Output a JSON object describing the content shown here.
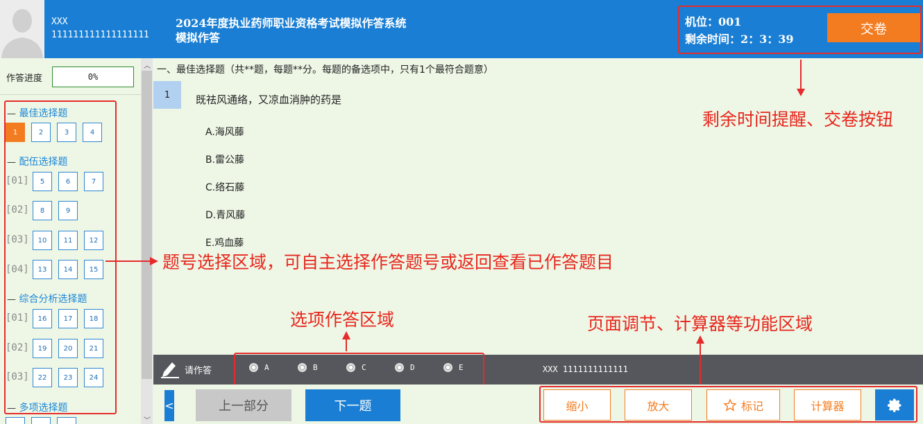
{
  "header": {
    "user_name": "XXX",
    "user_id": "111111111111111111",
    "title_line1": "2024年度执业药师职业资格考试模拟作答系统",
    "title_line2": "模拟作答",
    "seat_label": "机位：001",
    "time_label": "剩余时间：2：3：39",
    "submit_label": "交卷"
  },
  "sidebar": {
    "progress_label": "作答进度",
    "progress_value": "0%",
    "progress_fraction": 0,
    "sections": [
      {
        "title": "最佳选择题",
        "groups": [
          {
            "label": "",
            "items": [
              "1",
              "2",
              "3",
              "4"
            ]
          }
        ]
      },
      {
        "title": "配伍选择题",
        "groups": [
          {
            "label": "[01]",
            "items": [
              "5",
              "6",
              "7"
            ]
          },
          {
            "label": "[02]",
            "items": [
              "8",
              "9"
            ]
          },
          {
            "label": "[03]",
            "items": [
              "10",
              "11",
              "12"
            ]
          },
          {
            "label": "[04]",
            "items": [
              "13",
              "14",
              "15"
            ]
          }
        ]
      },
      {
        "title": "综合分析选择题",
        "groups": [
          {
            "label": "[01]",
            "items": [
              "16",
              "17",
              "18"
            ]
          },
          {
            "label": "[02]",
            "items": [
              "19",
              "20",
              "21"
            ]
          },
          {
            "label": "[03]",
            "items": [
              "22",
              "23",
              "24"
            ]
          }
        ]
      },
      {
        "title": "多项选择题",
        "groups": []
      }
    ],
    "current_question": "1"
  },
  "main": {
    "section_header": "一、最佳选择题（共**题，每题**分。每题的备选项中，只有1个最符合题意）",
    "question_number": "1",
    "question_stem": "既祛风通络，又凉血消肿的药是",
    "options": [
      "A.海风藤",
      "B.雷公藤",
      "C.络石藤",
      "D.青风藤",
      "E.鸡血藤"
    ]
  },
  "answer_bar": {
    "prompt": "请作答",
    "choices": [
      "A",
      "B",
      "C",
      "D",
      "E"
    ],
    "candidate_info": "XXX 1111111111111"
  },
  "bottom": {
    "prev_arrow": "<",
    "prev_part": "上一部分",
    "next_question": "下一题",
    "zoom_out": "缩小",
    "zoom_in": "放大",
    "mark": "标记",
    "calculator": "计算器"
  },
  "annotations": {
    "timer_note": "剩余时间提醒、交卷按钮",
    "nav_note": "题号选择区域，可自主选择作答题号或返回查看已作答题目",
    "answer_note": "选项作答区域",
    "tools_note": "页面调节、计算器等功能区域"
  },
  "colors": {
    "header_blue": "#1a7fd4",
    "accent_orange": "#f47c20",
    "annotation_red": "#e8261d",
    "content_bg": "#eef7e6"
  }
}
